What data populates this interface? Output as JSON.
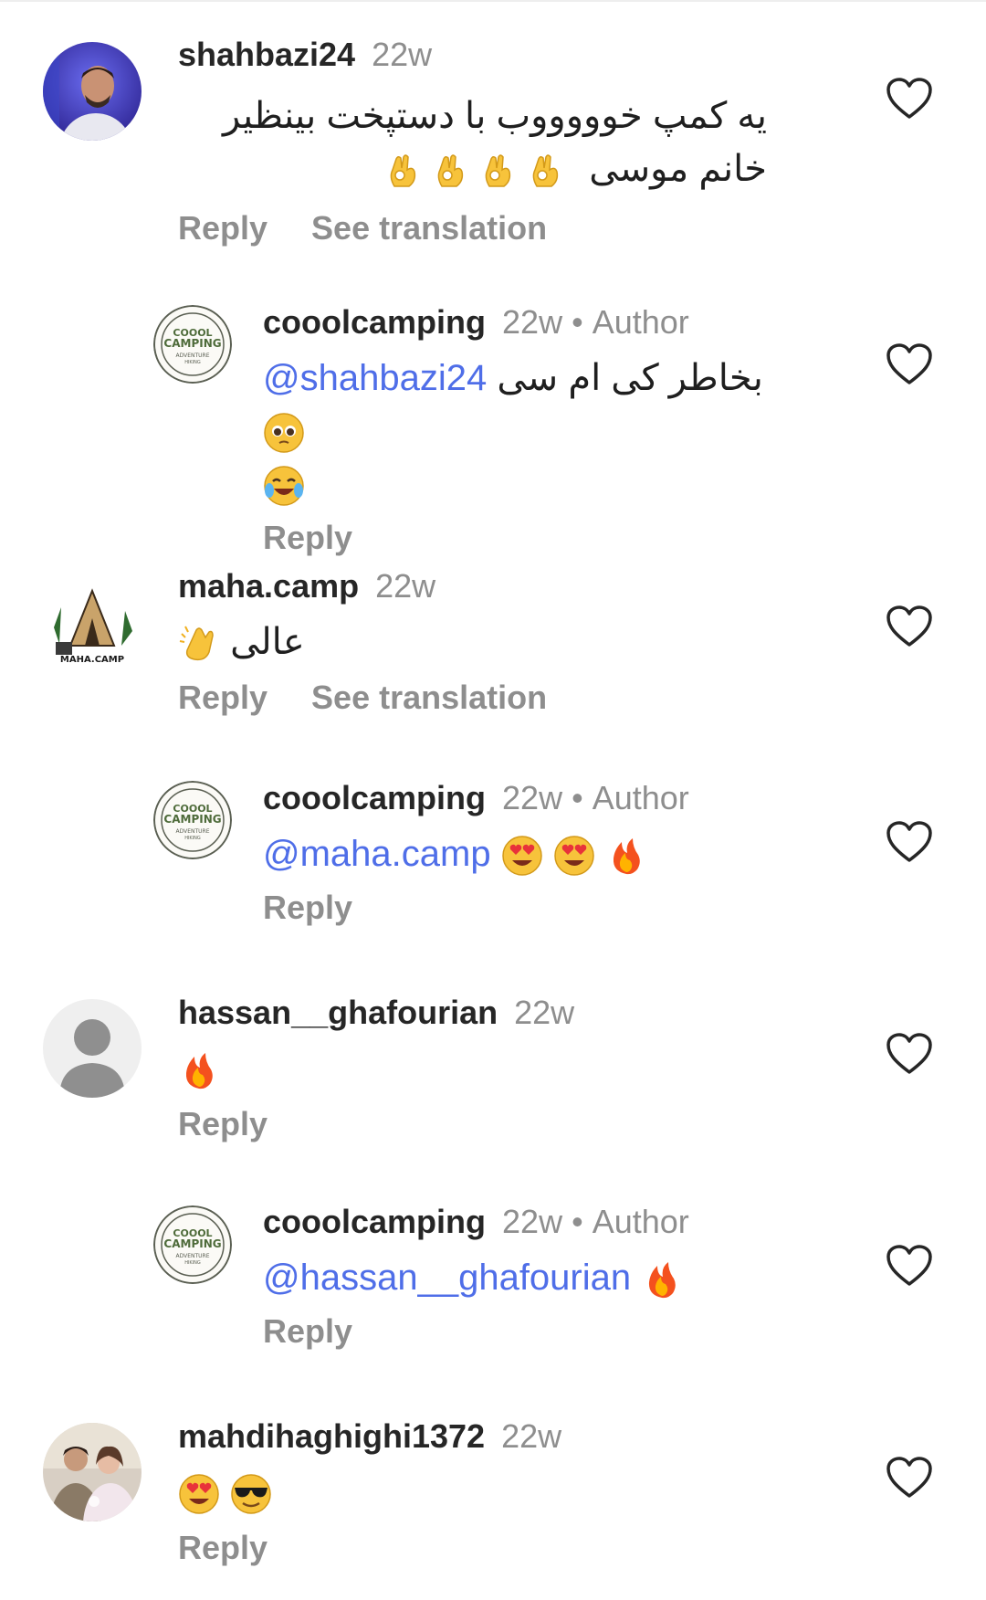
{
  "ui": {
    "reply_label": "Reply",
    "see_translation_label": "See translation",
    "author_label": "Author",
    "separator": "•"
  },
  "comments": [
    {
      "username": "shahbazi24",
      "time": "22w",
      "text": "یه کمپ خوووووب با دستپخت بینظیر خانم موسی",
      "emojis": [
        "ok-hand-emoji",
        "ok-hand-emoji",
        "ok-hand-emoji",
        "ok-hand-emoji"
      ],
      "avatar": "user-photo-avatar"
    },
    {
      "username": "cooolcamping",
      "time": "22w",
      "is_author": true,
      "mention": "@shahbazi24",
      "text": "بخاطر کی ام سی",
      "emojis": [
        "pleading-face-emoji",
        "tears-of-joy-emoji"
      ],
      "avatar": "cooolcamping-logo-avatar"
    },
    {
      "username": "maha.camp",
      "time": "22w",
      "text": "عالی",
      "emojis": [
        "clapping-hands-emoji"
      ],
      "avatar": "maha-camp-logo-avatar"
    },
    {
      "username": "cooolcamping",
      "time": "22w",
      "is_author": true,
      "mention": "@maha.camp",
      "emojis": [
        "heart-eyes-emoji",
        "heart-eyes-emoji",
        "fire-emoji"
      ],
      "avatar": "cooolcamping-logo-avatar"
    },
    {
      "username": "hassan__ghafourian",
      "time": "22w",
      "emojis": [
        "fire-emoji"
      ],
      "avatar": "default-user-avatar"
    },
    {
      "username": "cooolcamping",
      "time": "22w",
      "is_author": true,
      "mention": "@hassan__ghafourian",
      "emojis": [
        "fire-emoji"
      ],
      "avatar": "cooolcamping-logo-avatar"
    },
    {
      "username": "mahdihaghighi1372",
      "time": "22w",
      "emojis": [
        "heart-eyes-emoji",
        "sunglasses-emoji"
      ],
      "avatar": "couple-photo-avatar"
    }
  ],
  "colors": {
    "mention": "#4f6ee8",
    "secondary_text": "#8e8e8e",
    "primary_text": "#262626"
  }
}
